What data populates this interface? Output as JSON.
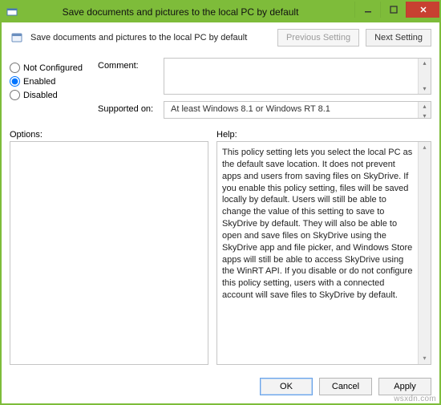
{
  "window": {
    "title": "Save documents and pictures to the local PC by default"
  },
  "header": {
    "label": "Save documents and pictures to the local PC by default",
    "previous_btn": "Previous Setting",
    "next_btn": "Next Setting"
  },
  "radios": {
    "not_configured": "Not Configured",
    "enabled": "Enabled",
    "disabled": "Disabled",
    "selected": "enabled"
  },
  "meta": {
    "comment_label": "Comment:",
    "comment_value": "",
    "supported_label": "Supported on:",
    "supported_value": "At least Windows 8.1 or Windows RT 8.1"
  },
  "sections": {
    "options_label": "Options:",
    "help_label": "Help:"
  },
  "options_text": "",
  "help_text": "This policy setting lets you select the local PC as the default save location. It does not prevent apps and users from saving files on SkyDrive. If you enable this policy setting, files will be saved locally by default. Users will still be able to change the value of this setting to save to SkyDrive by default. They will also be able to open and save files on SkyDrive using the SkyDrive app and file picker, and Windows Store apps will still be able to access SkyDrive using the WinRT API. If you disable or do not configure this policy setting, users with a connected account will save files to SkyDrive by default.",
  "footer": {
    "ok": "OK",
    "cancel": "Cancel",
    "apply": "Apply"
  },
  "watermark": "wsxdn.com"
}
